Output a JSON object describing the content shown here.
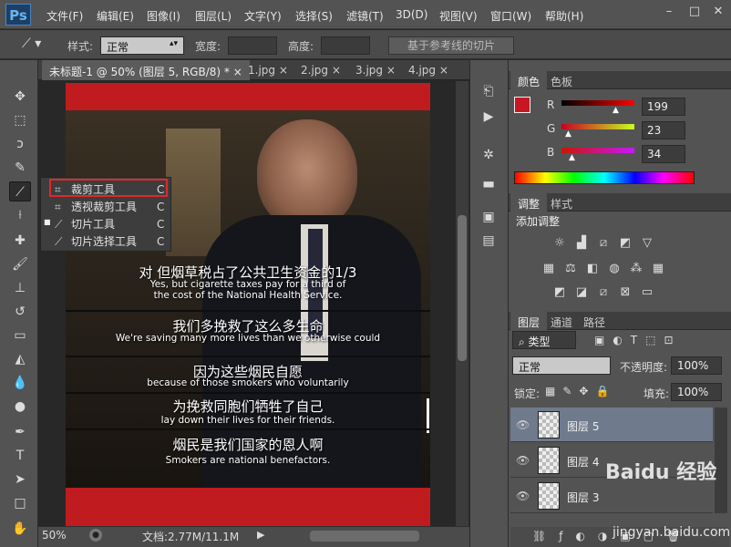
{
  "app": {
    "logo": "Ps"
  },
  "menus": [
    "文件(F)",
    "编辑(E)",
    "图像(I)",
    "图层(L)",
    "文字(Y)",
    "选择(S)",
    "滤镜(T)",
    "3D(D)",
    "视图(V)",
    "窗口(W)",
    "帮助(H)"
  ],
  "window_controls": [
    "–",
    "□",
    "✕"
  ],
  "options": {
    "style_label": "样式:",
    "style_value": "正常",
    "width_label": "宽度:",
    "height_label": "高度:",
    "slice_guides_button": "基于参考线的切片"
  },
  "tabs": [
    {
      "label": "未标题-1 @ 50% (图层 5, RGB/8) *",
      "active": true
    },
    {
      "label": "1.jpg"
    },
    {
      "label": "2.jpg"
    },
    {
      "label": "3.jpg"
    },
    {
      "label": "4.jpg"
    }
  ],
  "tab_close": "×",
  "flyout": {
    "items": [
      {
        "label": "裁剪工具",
        "key": "C"
      },
      {
        "label": "透视裁剪工具",
        "key": "C"
      },
      {
        "label": "切片工具",
        "key": "C"
      },
      {
        "label": "切片选择工具",
        "key": "C"
      }
    ]
  },
  "subtitles": [
    {
      "cn": "对 但烟草税占了公共卫生资金的1/3",
      "en": "Yes, but cigarette taxes pay for a third of the cost of the National Health Service."
    },
    {
      "cn": "我们多挽救了这么多生命",
      "en": "We're saving many more lives than we otherwise could"
    },
    {
      "cn": "因为这些烟民自愿",
      "en": "because of those smokers who voluntarily"
    },
    {
      "cn": "为挽救同胞们牺牲了自己",
      "en": "lay down their lives for their friends."
    },
    {
      "cn": "烟民是我们国家的恩人啊",
      "en": "Smokers are national benefactors."
    }
  ],
  "status": {
    "zoom": "50%",
    "doc_info": "文档:2.77M/11.1M"
  },
  "color_panel": {
    "tabs": [
      "颜色",
      "色板"
    ],
    "channels": [
      {
        "label": "R",
        "value": "199"
      },
      {
        "label": "G",
        "value": "23"
      },
      {
        "label": "B",
        "value": "34"
      }
    ],
    "foreground": "#c71722"
  },
  "adjust_panel": {
    "tabs": [
      "调整",
      "样式"
    ],
    "title": "添加调整"
  },
  "layers_panel": {
    "tabs": [
      "图层",
      "通道",
      "路径"
    ],
    "filter": "类型",
    "blend_mode": "正常",
    "opacity_label": "不透明度:",
    "opacity_value": "100%",
    "lock_label": "锁定:",
    "fill_label": "填充:",
    "fill_value": "100%",
    "layers": [
      {
        "name": "图层 5",
        "selected": true
      },
      {
        "name": "图层 4"
      },
      {
        "name": "图层 3"
      }
    ]
  },
  "watermark": {
    "text": "Baidu 经验",
    "url": "jingyan.baidu.com"
  }
}
